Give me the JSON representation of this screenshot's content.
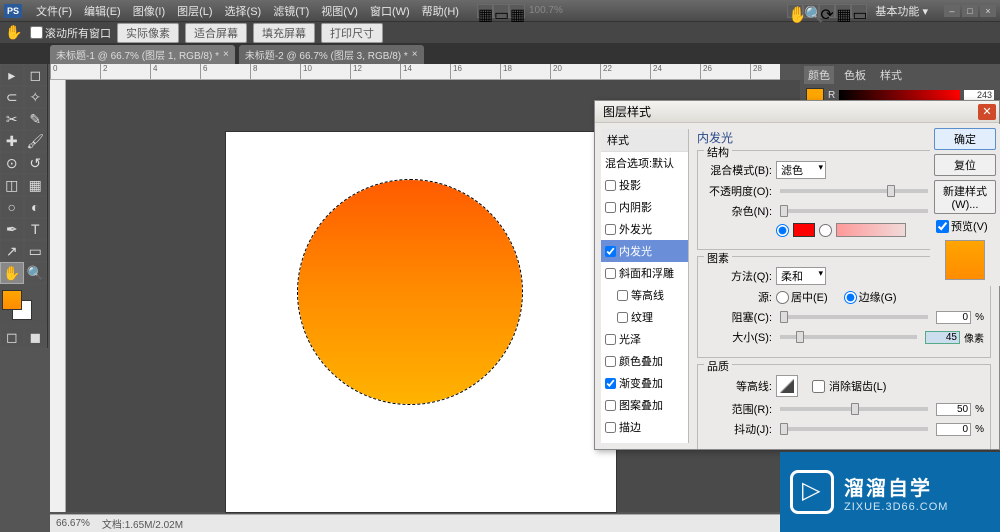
{
  "app_icon": "PS",
  "menu": {
    "file": "文件(F)",
    "edit": "编辑(E)",
    "image": "图像(I)",
    "layer": "图层(L)",
    "select": "选择(S)",
    "filter": "滤镜(T)",
    "view": "视图(V)",
    "window": "窗口(W)",
    "help": "帮助(H)"
  },
  "top": {
    "zoom": "100.7%",
    "workspace": "基本功能"
  },
  "options": {
    "scroll_all_windows": "滚动所有窗口",
    "actual_pixels": "实际像素",
    "fit_screen": "适合屏幕",
    "fill_screen": "填充屏幕",
    "print_size": "打印尺寸"
  },
  "tabs": {
    "tab1": "未标题-1 @ 66.7% (图层 1, RGB/8) *",
    "tab2": "未标题-2 @ 66.7% (图层 3, RGB/8) *"
  },
  "ruler_marks": [
    "0",
    "2",
    "4",
    "6",
    "8",
    "10",
    "12",
    "14",
    "16",
    "18",
    "20",
    "22",
    "24",
    "26",
    "28"
  ],
  "panels": {
    "color": "颜色",
    "swatches": "色板",
    "styles": "样式",
    "r_label": "R",
    "r_value": "243"
  },
  "dialog": {
    "title": "图层样式",
    "styles_header": "样式",
    "blend_options": "混合选项:默认",
    "items": {
      "drop_shadow": "投影",
      "inner_shadow": "内阴影",
      "outer_glow": "外发光",
      "inner_glow": "内发光",
      "bevel": "斜面和浮雕",
      "contour": "等高线",
      "texture": "纹理",
      "satin": "光泽",
      "color_overlay": "颜色叠加",
      "gradient_overlay": "渐变叠加",
      "pattern_overlay": "图案叠加",
      "stroke": "描边"
    },
    "section_title": "内发光",
    "structure": "结构",
    "blend_mode_label": "混合模式(B):",
    "blend_mode_value": "滤色",
    "opacity_label": "不透明度(O):",
    "opacity_value": "75",
    "noise_label": "杂色(N):",
    "noise_value": "0",
    "elements": "图素",
    "technique_label": "方法(Q):",
    "technique_value": "柔和",
    "source_label": "源:",
    "source_center": "居中(E)",
    "source_edge": "边缘(G)",
    "choke_label": "阻塞(C):",
    "choke_value": "0",
    "size_label": "大小(S):",
    "size_value": "45",
    "size_unit": "像素",
    "quality": "品质",
    "contour_label": "等高线:",
    "antialias": "消除锯齿(L)",
    "range_label": "范围(R):",
    "range_value": "50",
    "jitter_label": "抖动(J):",
    "jitter_value": "0",
    "pct": "%",
    "ok": "确定",
    "cancel": "复位",
    "new_style": "新建样式(W)...",
    "preview": "预览(V)"
  },
  "status": {
    "zoom": "66.67%",
    "doc_size": "文档:1.65M/2.02M"
  },
  "watermark": {
    "text_big": "溜溜自学",
    "text_small": "ZIXUE.3D66.COM"
  }
}
